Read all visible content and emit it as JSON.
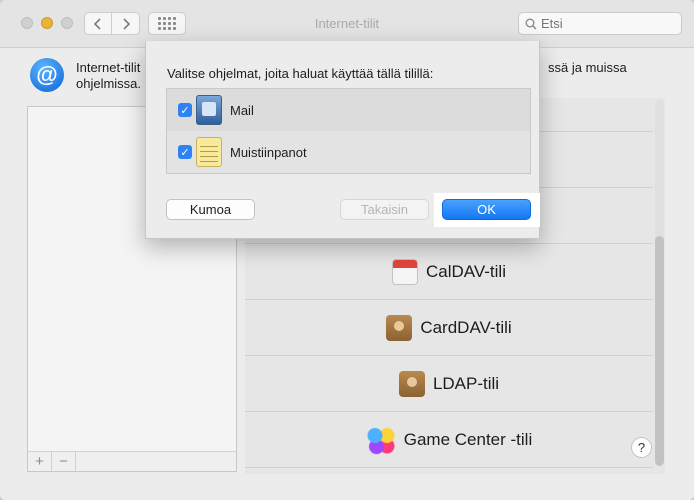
{
  "window": {
    "title": "Internet-tilit"
  },
  "search": {
    "placeholder": "Etsi"
  },
  "header": {
    "description_line1": "Internet-tilit",
    "description_line2": "ohjelmissa.",
    "description_right": "ssä ja muissa"
  },
  "list_footer": {
    "add": "+",
    "remove": "−"
  },
  "providers": [
    {
      "label": "CalDAV-tili",
      "icon": "calendar-icon"
    },
    {
      "label": "CardDAV-tili",
      "icon": "contacts-icon"
    },
    {
      "label": "LDAP-tili",
      "icon": "contacts-icon"
    },
    {
      "label": "Game Center -tili",
      "icon": "game-center-icon"
    }
  ],
  "help": "?",
  "sheet": {
    "prompt": "Valitse ohjelmat, joita haluat käyttää tällä tilillä:",
    "apps": [
      {
        "label": "Mail",
        "checked": true,
        "icon": "mail-icon"
      },
      {
        "label": "Muistiinpanot",
        "checked": true,
        "icon": "notes-icon"
      }
    ],
    "cancel_label": "Kumoa",
    "back_label": "Takaisin",
    "ok_label": "OK"
  }
}
